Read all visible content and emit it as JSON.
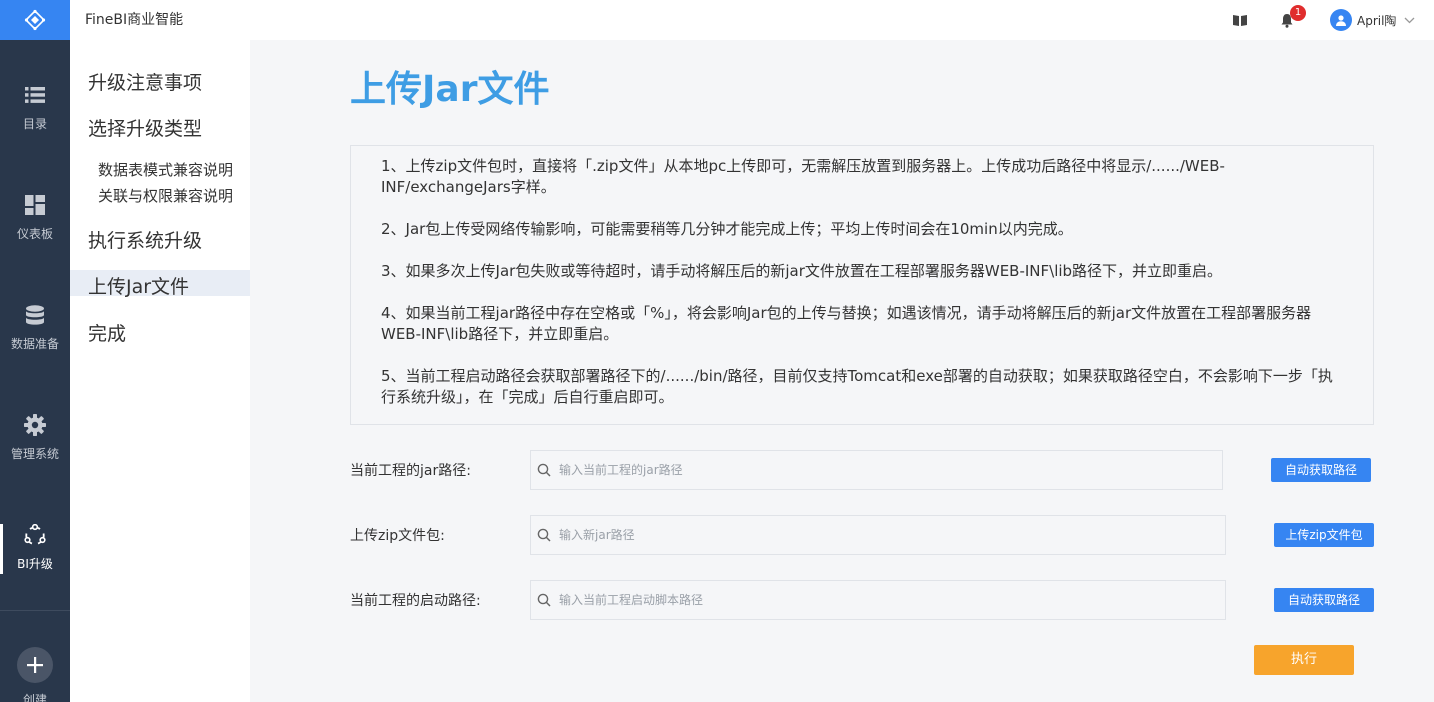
{
  "header": {
    "app_title": "FineBI商业智能",
    "notification_count": "1",
    "user_name": "April陶",
    "accent_color": "#3685f2"
  },
  "leftnav": {
    "items": [
      {
        "label": "目录",
        "icon": "list-icon"
      },
      {
        "label": "仪表板",
        "icon": "dashboard-icon"
      },
      {
        "label": "数据准备",
        "icon": "database-icon"
      },
      {
        "label": "管理系统",
        "icon": "gear-icon"
      },
      {
        "label": "BI升级",
        "icon": "upgrade-icon"
      }
    ],
    "active_item": "BI升级",
    "create_label": "创建"
  },
  "steps": {
    "items": [
      "升级注意事项",
      "选择升级类型",
      "数据表模式兼容说明",
      "关联与权限兼容说明",
      "执行系统升级",
      "上传Jar文件",
      "完成"
    ],
    "active_item": "上传Jar文件"
  },
  "main": {
    "title": "上传Jar文件",
    "notes": [
      "1、上传zip文件包时，直接将「.zip文件」从本地pc上传即可，无需解压放置到服务器上。上传成功后路径中将显示/....../WEB-INF/exchangeJars字样。",
      "2、Jar包上传受网络传输影响，可能需要稍等几分钟才能完成上传；平均上传时间会在10min以内完成。",
      "3、如果多次上传Jar包失败或等待超时，请手动将解压后的新jar文件放置在工程部署服务器WEB-INF\\lib路径下，并立即重启。",
      "4、如果当前工程jar路径中存在空格或「%」，将会影响Jar包的上传与替换；如遇该情况，请手动将解压后的新jar文件放置在工程部署服务器WEB-INF\\lib路径下，并立即重启。",
      "5、当前工程启动路径会获取部署路径下的/....../bin/路径，目前仅支持Tomcat和exe部署的自动获取；如果获取路径空白，不会影响下一步「执行系统升级」，在「完成」后自行重启即可。"
    ],
    "form": {
      "jar_path": {
        "label": "当前工程的jar路径:",
        "value": "",
        "placeholder": "输入当前工程的jar路径",
        "button_label": "自动获取路径"
      },
      "zip_upload": {
        "label": "上传zip文件包:",
        "value": "",
        "placeholder": "输入新jar路径",
        "button_label": "上传zip文件包"
      },
      "startup_path": {
        "label": "当前工程的启动路径:",
        "value": "",
        "placeholder": "输入当前工程启动脚本路径",
        "button_label": "自动获取路径"
      }
    },
    "execute_label": "执行",
    "execute_color": "#f7a42c"
  }
}
